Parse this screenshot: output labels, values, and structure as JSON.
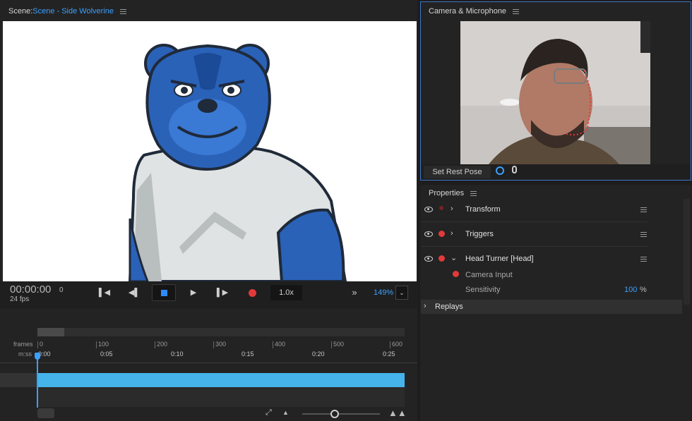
{
  "scene": {
    "prefix": "Scene:",
    "name": "Scene - Side Wolverine"
  },
  "transport": {
    "timecode": "00:00:00",
    "frame": "0",
    "fps": "24 fps",
    "speed": "1.0x",
    "zoom": "149%"
  },
  "camera_panel": {
    "title": "Camera & Microphone",
    "set_rest_pose": "Set Rest Pose"
  },
  "properties": {
    "title": "Properties",
    "rows": [
      {
        "label": "Transform"
      },
      {
        "label": "Triggers"
      },
      {
        "label": "Head Turner [Head]"
      }
    ],
    "camera_input": "Camera Input",
    "sensitivity_label": "Sensitivity",
    "sensitivity_value": "100",
    "sensitivity_unit": "%",
    "replays": "Replays"
  },
  "timeline": {
    "frames_label": "frames",
    "mss_label": "m:ss",
    "frame_ticks": [
      "0",
      "100",
      "200",
      "300",
      "400",
      "500",
      "600"
    ],
    "time_ticks": [
      "0:00",
      "0:05",
      "0:10",
      "0:15",
      "0:20",
      "0:25"
    ]
  },
  "colors": {
    "accent": "#3ba0ff",
    "track": "#45b4eb",
    "record": "#e23a3a",
    "stop": "#2e8bff"
  }
}
